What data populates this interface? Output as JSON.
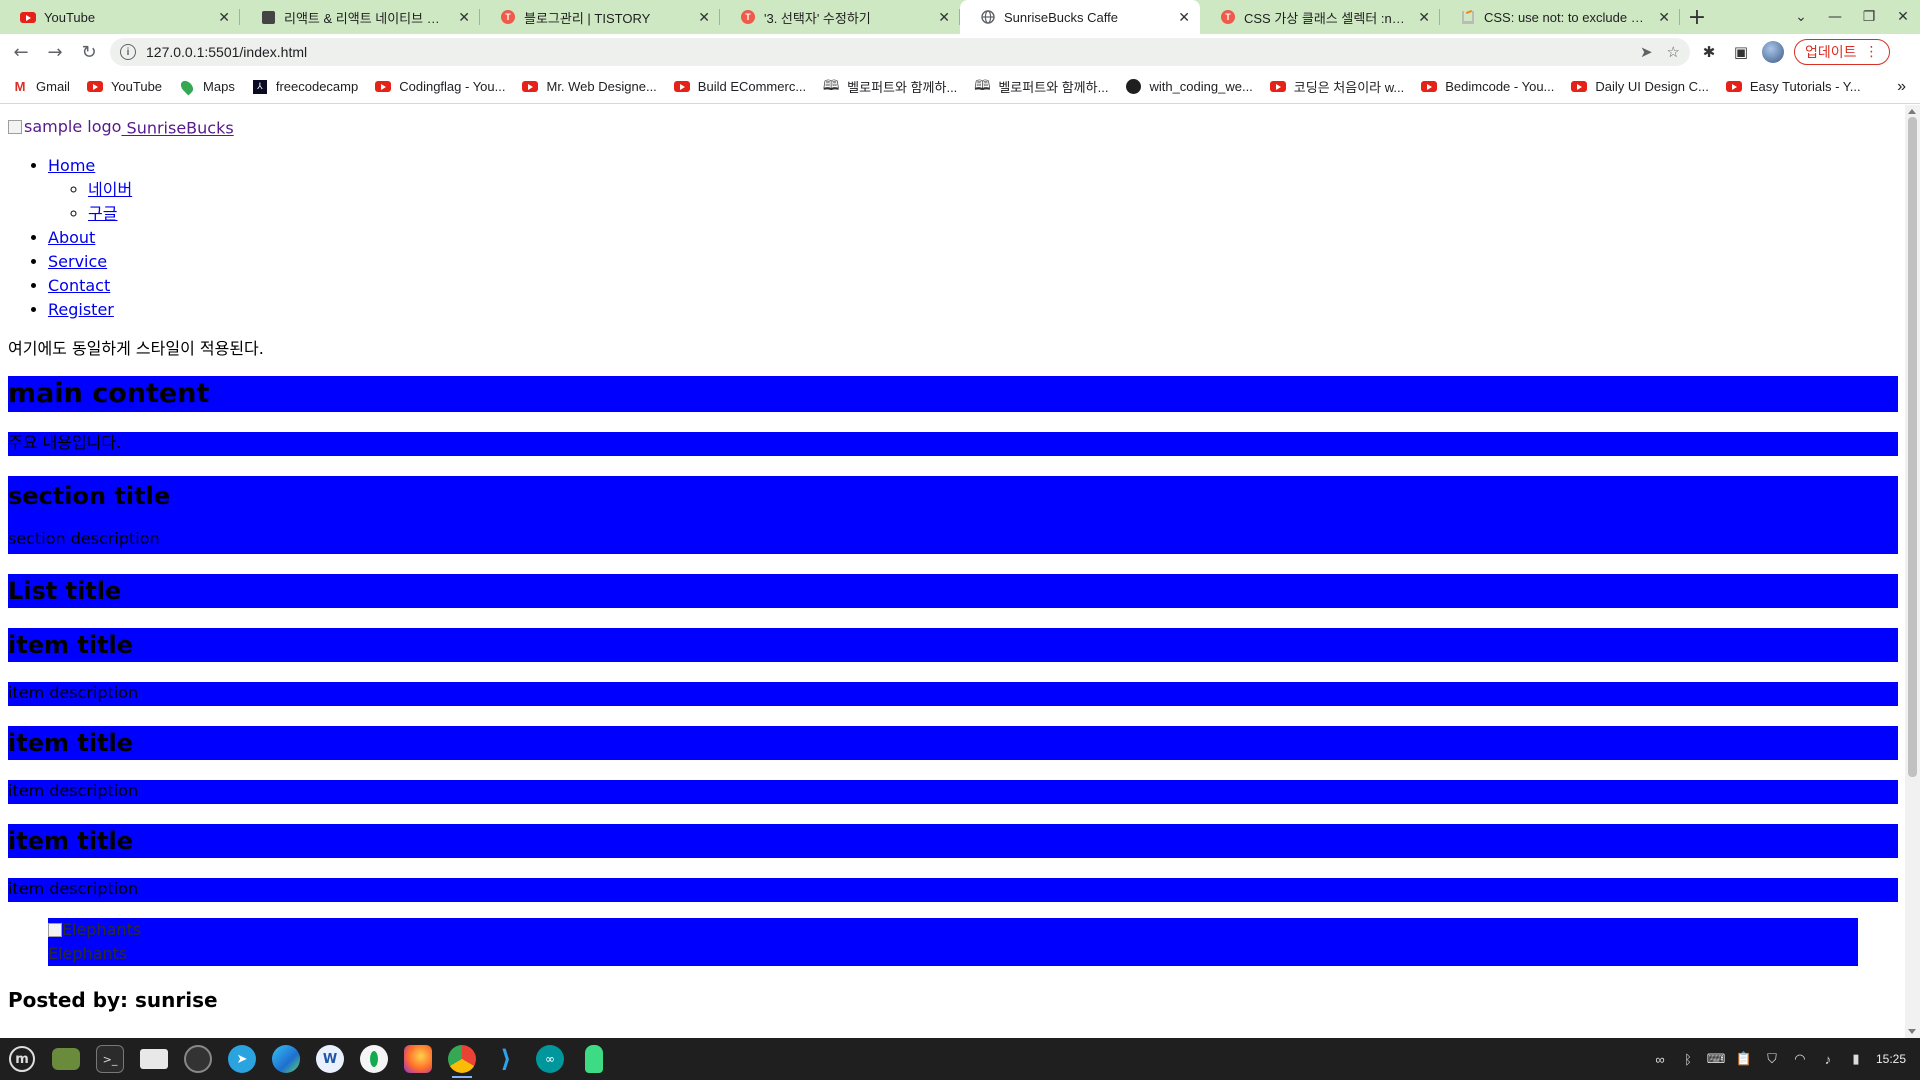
{
  "browser": {
    "tabs": [
      {
        "title": "YouTube",
        "icon": "youtube-icon",
        "active": false
      },
      {
        "title": "리액트 & 리액트 네이티브 과정 ®",
        "icon": "page-icon",
        "active": false
      },
      {
        "title": "블로그관리 | TISTORY",
        "icon": "tistory-icon",
        "active": false
      },
      {
        "title": "'3. 선택자' 수정하기",
        "icon": "tistory-icon",
        "active": false
      },
      {
        "title": "SunriseBucks Caffe",
        "icon": "globe-icon",
        "active": true
      },
      {
        "title": "CSS 가상 클래스 셀렉터 :nth-chil",
        "icon": "tistory-icon",
        "active": false
      },
      {
        "title": "CSS: use not: to exclude not o",
        "icon": "stackoverflow-icon",
        "active": false
      }
    ],
    "new_tab": "+",
    "url": "127.0.0.1:5501/index.html",
    "update_label": "업데이트",
    "bookmarks": [
      {
        "label": "Gmail",
        "icon": "gmail-icon"
      },
      {
        "label": "YouTube",
        "icon": "youtube-icon"
      },
      {
        "label": "Maps",
        "icon": "maps-icon"
      },
      {
        "label": "freecodecamp",
        "icon": "freecodecamp-icon"
      },
      {
        "label": "Codingflag - You...",
        "icon": "youtube-icon"
      },
      {
        "label": "Mr. Web Designe...",
        "icon": "youtube-icon"
      },
      {
        "label": "Build ECommerc...",
        "icon": "youtube-icon"
      },
      {
        "label": "벨로퍼트와 함께하...",
        "icon": "book-icon"
      },
      {
        "label": "벨로퍼트와 함께하...",
        "icon": "book-icon"
      },
      {
        "label": "with_coding_we...",
        "icon": "github-icon"
      },
      {
        "label": "코딩은 처음이라 w...",
        "icon": "youtube-icon"
      },
      {
        "label": "Bedimcode - You...",
        "icon": "youtube-icon"
      },
      {
        "label": "Daily UI Design C...",
        "icon": "youtube-icon"
      },
      {
        "label": "Easy Tutorials - Y...",
        "icon": "youtube-icon"
      }
    ]
  },
  "page": {
    "logo": {
      "alt": "sample logo",
      "text": "SunriseBucks"
    },
    "nav": [
      {
        "label": "Home",
        "children": [
          {
            "label": "네이버"
          },
          {
            "label": "구글"
          }
        ]
      },
      {
        "label": "About"
      },
      {
        "label": "Service"
      },
      {
        "label": "Contact"
      },
      {
        "label": "Register"
      }
    ],
    "intro": "여기에도 동일하게 스타일이 적용된다.",
    "main_title": "main content",
    "main_desc": "주요 내용입니다.",
    "section_title": "section title",
    "section_desc": "section description",
    "list_title": "List title",
    "items": [
      {
        "title": "item title",
        "desc": "item description"
      },
      {
        "title": "item title",
        "desc": "item description"
      },
      {
        "title": "item title",
        "desc": "item description"
      }
    ],
    "figure": {
      "img_alt": "Elephants",
      "caption": "Elephants"
    },
    "posted_by": "Posted by: sunrise"
  },
  "taskbar": {
    "clock": "15:25"
  },
  "colors": {
    "block_bg": "#0000ff",
    "tabstrip_bg": "#cfe8c4",
    "update_accent": "#d93025"
  }
}
